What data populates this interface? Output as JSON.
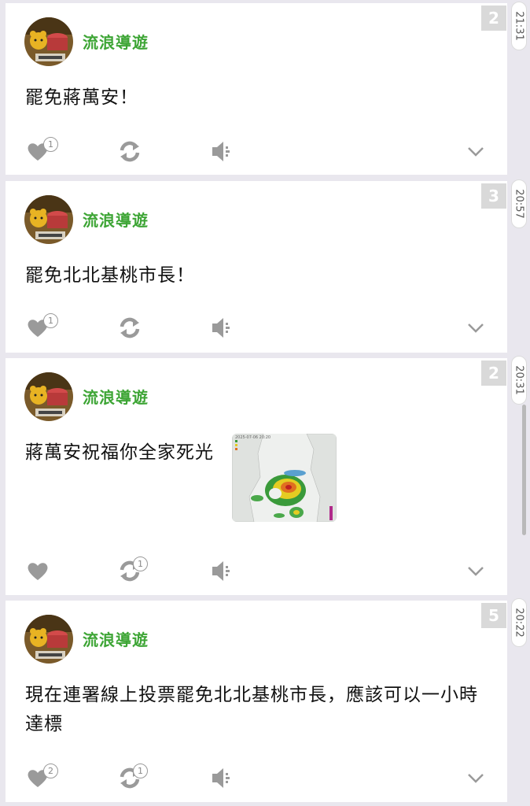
{
  "posts": [
    {
      "badge": "2",
      "author": "流浪導遊",
      "text": "罷免蔣萬安！",
      "like_count": "1",
      "share_count": "",
      "time": "21:31",
      "has_image": false
    },
    {
      "badge": "3",
      "author": "流浪導遊",
      "text": "罷免北北基桃市長！",
      "like_count": "1",
      "share_count": "",
      "time": "20:57",
      "has_image": false
    },
    {
      "badge": "2",
      "author": "流浪導遊",
      "text": "蔣萬安祝福你全家死光",
      "like_count": "",
      "share_count": "1",
      "time": "20:31",
      "has_image": true,
      "image_caption": "2025-07-06 20:20"
    },
    {
      "badge": "5",
      "author": "流浪導遊",
      "text": "現在連署線上投票罷免北北基桃市長，應該可以一小時達標",
      "like_count": "2",
      "share_count": "1",
      "time": "20:22",
      "has_image": false
    }
  ],
  "icons": {
    "like": "heart-icon",
    "share": "share-icon",
    "speaker": "speaker-icon",
    "expand": "chevron-down-icon"
  },
  "colors": {
    "author": "#3da535",
    "icon": "#9a9a9a",
    "badge": "#d9d9d9",
    "background": "#e9e7ee"
  }
}
